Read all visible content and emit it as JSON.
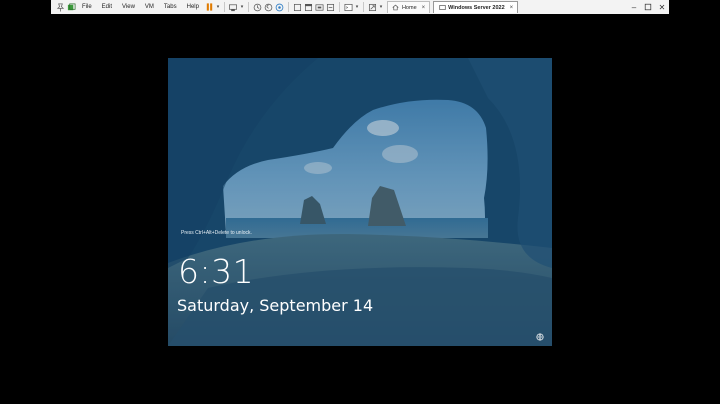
{
  "menu": [
    "File",
    "Edit",
    "View",
    "VM",
    "Tabs",
    "Help"
  ],
  "tabs": [
    {
      "label": "Home",
      "active": false
    },
    {
      "label": "Windows Server 2022",
      "active": true
    }
  ],
  "lockscreen": {
    "hint": "Press Ctrl+Alt+Delete to unlock.",
    "time": "6:31",
    "date": "Saturday, September 14"
  },
  "icons": [
    "pin-icon",
    "vm-library-icon",
    "pause-icon",
    "send-keys-icon",
    "snapshot-icon",
    "revert-snapshot-icon",
    "snapshot-manager-icon",
    "view-icon",
    "console-icon",
    "fullscreen-icon",
    "network-icon"
  ],
  "colors": {
    "toolbar_bg": "#f3f3f3",
    "pause_accent": "#e07b00",
    "screen_overlay": "#0e3a5e"
  }
}
